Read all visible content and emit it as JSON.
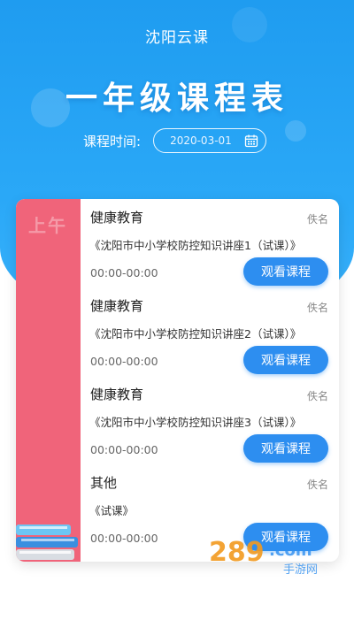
{
  "app": {
    "title": "沈阳云课"
  },
  "page": {
    "title": "一年级课程表"
  },
  "date": {
    "label": "课程时间:",
    "value": "2020-03-01"
  },
  "schedule": {
    "period_label": "上午",
    "courses": [
      {
        "name": "健康教育",
        "teacher": "佚名",
        "lesson": "《沈阳市中小学校防控知识讲座1（试课）》",
        "time": "00:00-00:00",
        "button": "观看课程"
      },
      {
        "name": "健康教育",
        "teacher": "佚名",
        "lesson": "《沈阳市中小学校防控知识讲座2（试课）》",
        "time": "00:00-00:00",
        "button": "观看课程"
      },
      {
        "name": "健康教育",
        "teacher": "佚名",
        "lesson": "《沈阳市中小学校防控知识讲座3（试课）》",
        "time": "00:00-00:00",
        "button": "观看课程"
      },
      {
        "name": "其他",
        "teacher": "佚名",
        "lesson": "《试课》",
        "time": "00:00-00:00",
        "button": "观看课程"
      }
    ]
  },
  "watermark": {
    "text": "289.com 手游网"
  },
  "colors": {
    "header": "#1f9cf0",
    "side": "#f0647a",
    "button": "#2d8ef0"
  }
}
